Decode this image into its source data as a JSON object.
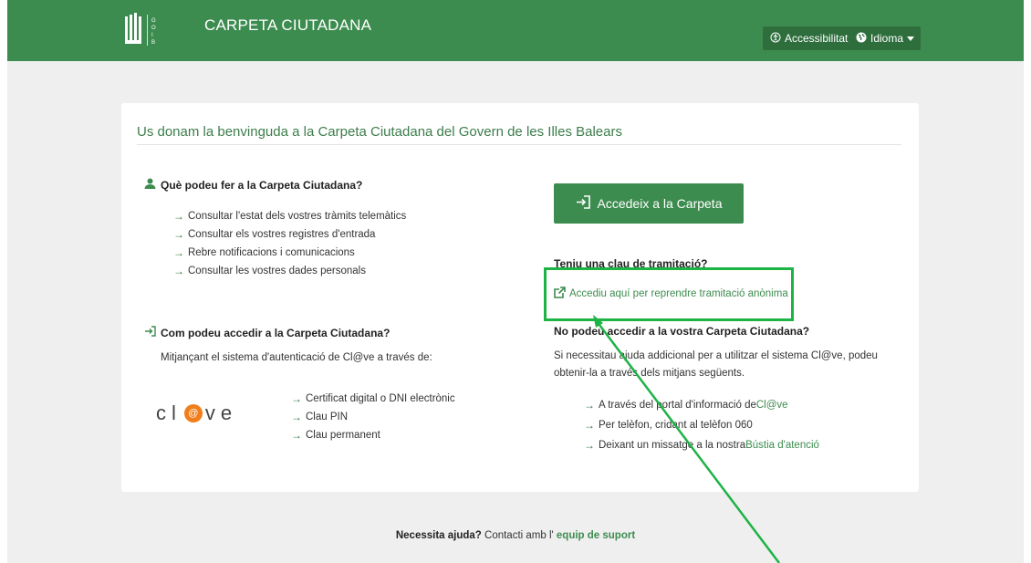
{
  "header": {
    "brand": "CARPETA CIUTADANA",
    "logo_sub": "GOIB",
    "accessibility_label": "Accessibilitat",
    "language_label": "Idioma"
  },
  "card": {
    "title": "Us donam la benvinguda a la Carpeta Ciutadana del Govern de les Illes Balears",
    "what_heading": "Què podeu fer a la Carpeta Ciutadana?",
    "what_items": [
      "Consultar l'estat dels vostres tràmits telemàtics",
      "Consultar els vostres registres d'entrada",
      "Rebre notificacions i comunicacions",
      "Consultar les vostres dades personals"
    ],
    "access_button": "Accedeix a la Carpeta",
    "claim_heading": "Teniu una clau de tramitació?",
    "anon_link": "Accediu aquí per reprendre tramitació anònima",
    "how_heading": "Com podeu accedir a la Carpeta Ciutadana?",
    "how_text": "Mitjançant el sistema d'autenticació de Cl@ve a través de:",
    "clave_logo": "cl@ve",
    "clave_items": [
      "Certificat digital o DNI electrònic",
      "Clau PIN",
      "Clau permanent"
    ],
    "noaccess_heading": "No podeu accedir a la vostra Carpeta Ciutadana?",
    "noaccess_text_1": "Si necessitau ajuda addicional per a utilitzar el sistema Cl@ve, podeu",
    "noaccess_text_2": "obtenir-la a través dels mitjans següents.",
    "help_1_prefix": "A través del portal d'informació de ",
    "help_1_link": "Cl@ve",
    "help_2": "Per telèfon, cridant al telèfon 060",
    "help_3_prefix": "Deixant un missatge a la nostra ",
    "help_3_link": "Bústia d'atenció"
  },
  "footer": {
    "bold": "Necessita ajuda?",
    "text": " Contacti amb l' ",
    "link": "equip de suport"
  },
  "colors": {
    "brand_green": "#3d8c4f",
    "highlight": "#1db345",
    "clave_orange": "#f07e1b"
  },
  "icons": [
    "user-icon",
    "sign-in-icon",
    "external-link-icon",
    "accessibility-icon",
    "globe-icon",
    "caret-down-icon",
    "arrow-right-icon"
  ]
}
